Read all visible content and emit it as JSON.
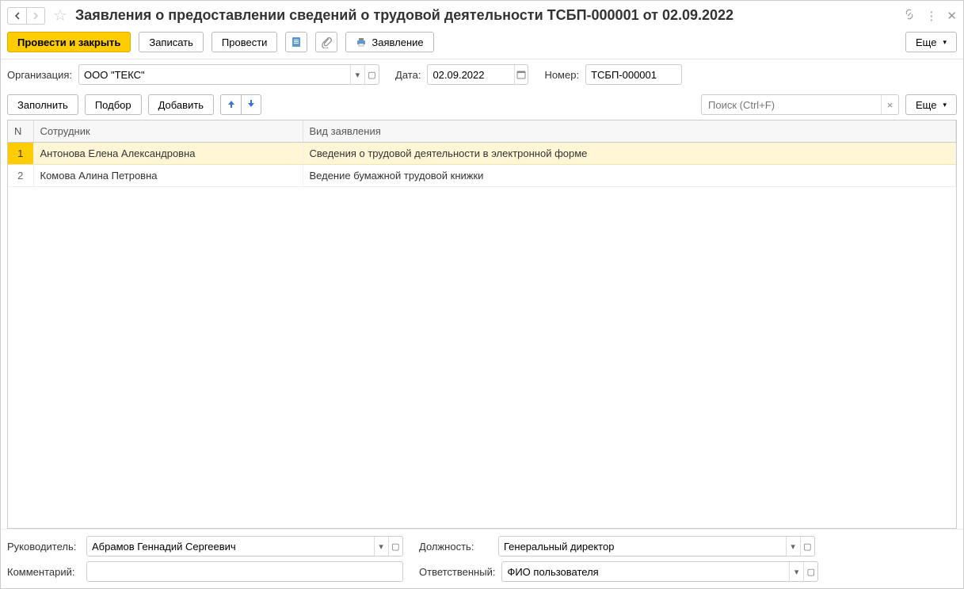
{
  "window": {
    "title": "Заявления о предоставлении сведений о трудовой деятельности ТСБП-000001 от 02.09.2022"
  },
  "toolbar": {
    "post_and_close": "Провести и закрыть",
    "save": "Записать",
    "post": "Провести",
    "print_statement": "Заявление",
    "more": "Еще"
  },
  "fields": {
    "organization_label": "Организация:",
    "organization_value": "ООО \"ТЕКС\"",
    "date_label": "Дата:",
    "date_value": "02.09.2022",
    "number_label": "Номер:",
    "number_value": "ТСБП-000001"
  },
  "subtoolbar": {
    "fill": "Заполнить",
    "select": "Подбор",
    "add": "Добавить",
    "search_placeholder": "Поиск (Ctrl+F)",
    "more": "Еще"
  },
  "table": {
    "columns": {
      "n": "N",
      "employee": "Сотрудник",
      "type": "Вид заявления"
    },
    "rows": [
      {
        "n": "1",
        "employee": "Антонова Елена Александровна",
        "type": "Сведения о трудовой деятельности в электронной форме",
        "selected": true
      },
      {
        "n": "2",
        "employee": "Комова Алина Петровна",
        "type": "Ведение бумажной трудовой книжки",
        "selected": false
      }
    ]
  },
  "footer": {
    "manager_label": "Руководитель:",
    "manager_value": "Абрамов Геннадий Сергеевич",
    "position_label": "Должность:",
    "position_value": "Генеральный директор",
    "comment_label": "Комментарий:",
    "comment_value": "",
    "responsible_label": "Ответственный:",
    "responsible_value": "ФИО пользователя"
  }
}
